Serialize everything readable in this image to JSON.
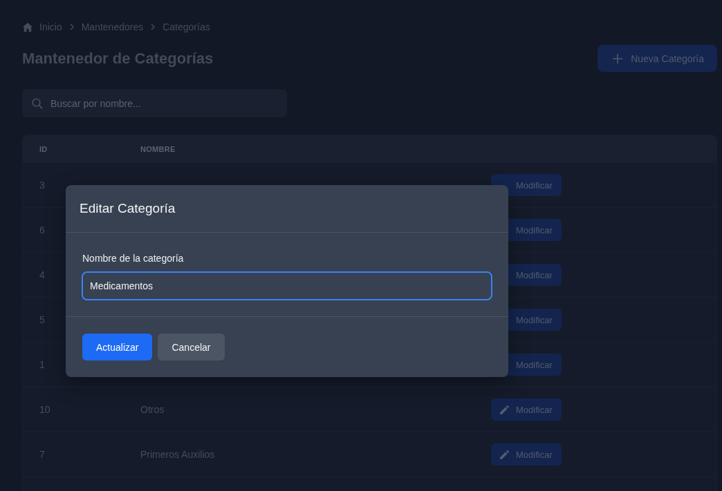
{
  "breadcrumb": [
    {
      "label": "Inicio"
    },
    {
      "label": "Mantenedores"
    },
    {
      "label": "Categorías"
    }
  ],
  "header": {
    "title": "Mantenedor de Categorías",
    "new_button": "Nueva Categoría"
  },
  "search": {
    "placeholder": "Buscar por nombre..."
  },
  "table": {
    "columns": [
      "ID",
      "NOMBRE"
    ],
    "rows": [
      {
        "id": "3",
        "action": "Modificar"
      },
      {
        "id": "6",
        "action": "Modificar"
      },
      {
        "id": "4",
        "action": "Modificar"
      },
      {
        "id": "5",
        "action": "Modificar"
      },
      {
        "id": "1",
        "action": "Modificar"
      },
      {
        "id": "10",
        "name": "Otros",
        "action": "Modificar"
      },
      {
        "id": "7",
        "name": "Primeros Auxilios",
        "action": "Modificar"
      }
    ]
  },
  "dialog": {
    "title": "Editar Categoría",
    "field": {
      "label": "Nombre de la categoría",
      "value": "Medicamentos",
      "focused": true
    },
    "buttons": [
      {
        "label": "Actualizar",
        "kind": "primary"
      },
      {
        "label": "Cancelar",
        "kind": "secondary"
      }
    ]
  }
}
